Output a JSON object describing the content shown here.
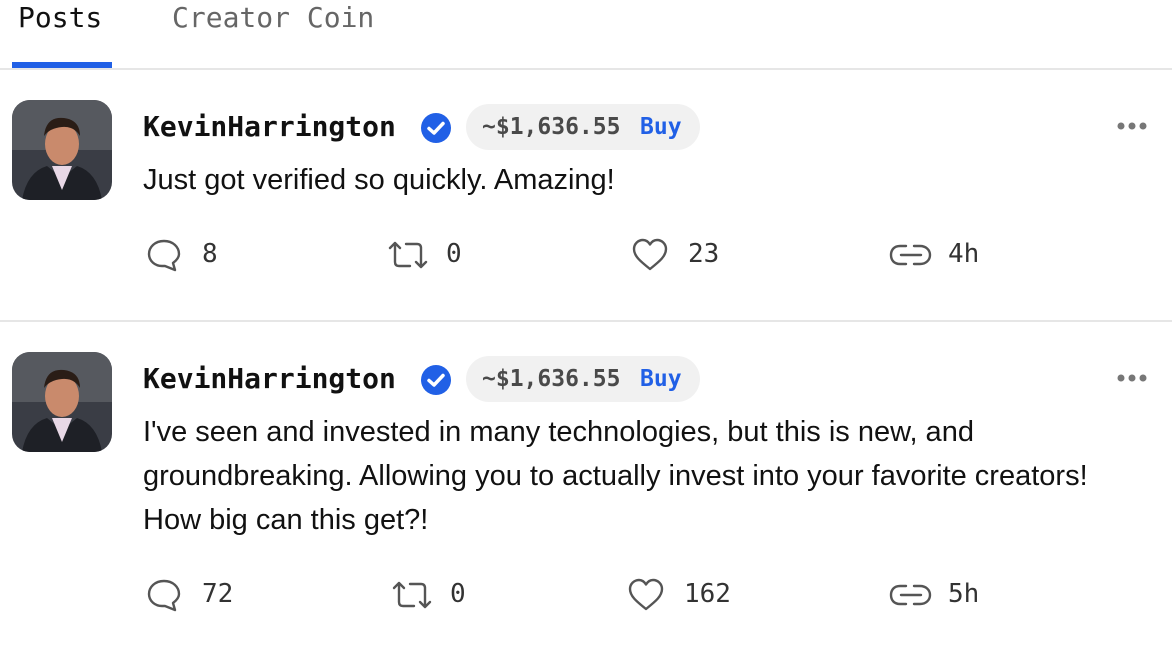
{
  "tabs": [
    {
      "label": "Posts",
      "active": true
    },
    {
      "label": "Creator Coin",
      "active": false
    }
  ],
  "accent_color": "#2160e6",
  "posts": [
    {
      "username": "KevinHarrington",
      "verified": true,
      "coin_price": "~$1,636.55",
      "buy_label": "Buy",
      "text": "Just got verified so quickly. Amazing!",
      "comments": "8",
      "reposts": "0",
      "likes": "23",
      "age": "4h"
    },
    {
      "username": "KevinHarrington",
      "verified": true,
      "coin_price": "~$1,636.55",
      "buy_label": "Buy",
      "text": "I've seen and invested in many technologies, but this is new, and groundbreaking. Allowing you to actually invest into your favorite creators! How big can this get?!",
      "comments": "72",
      "reposts": "0",
      "likes": "162",
      "age": "5h"
    }
  ],
  "icons": {
    "comment": "comment-icon",
    "repost": "repost-icon",
    "like": "heart-icon",
    "link": "link-icon",
    "more": "more-icon",
    "verified": "verified-badge-icon"
  }
}
